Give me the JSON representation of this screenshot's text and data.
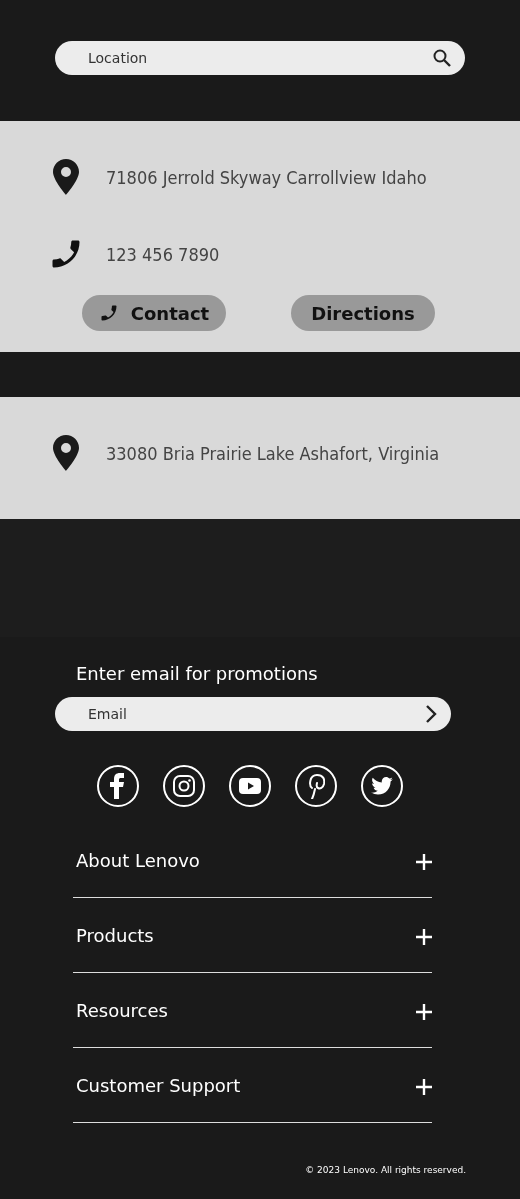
{
  "search": {
    "placeholder": "Location"
  },
  "stores": [
    {
      "clipped": false,
      "rows": [
        {
          "kind": "address",
          "text": "71806 Jerrold Skyway Carrollview Idaho"
        },
        {
          "kind": "phone",
          "text": "123 456 7890"
        }
      ],
      "buttons": [
        {
          "label": "Contact",
          "kind": "phone"
        },
        {
          "label": "Directions",
          "kind": "plain"
        }
      ]
    },
    {
      "clipped": true,
      "rows": [
        {
          "kind": "address",
          "text": "33080 Bria Prairie Lake Ashafort, Virginia"
        }
      ]
    }
  ],
  "footer": {
    "promo_label": "Enter email for promotions",
    "email": {
      "placeholder": "Email"
    },
    "sections": [
      {
        "label": "About Lenovo",
        "expanded": false
      },
      {
        "label": "Products",
        "expanded": false
      },
      {
        "label": "Resources",
        "expanded": false
      },
      {
        "label": "Customer Support",
        "expanded": false
      }
    ],
    "copyright": "© 2023 Lenovo. All rights reserved."
  }
}
